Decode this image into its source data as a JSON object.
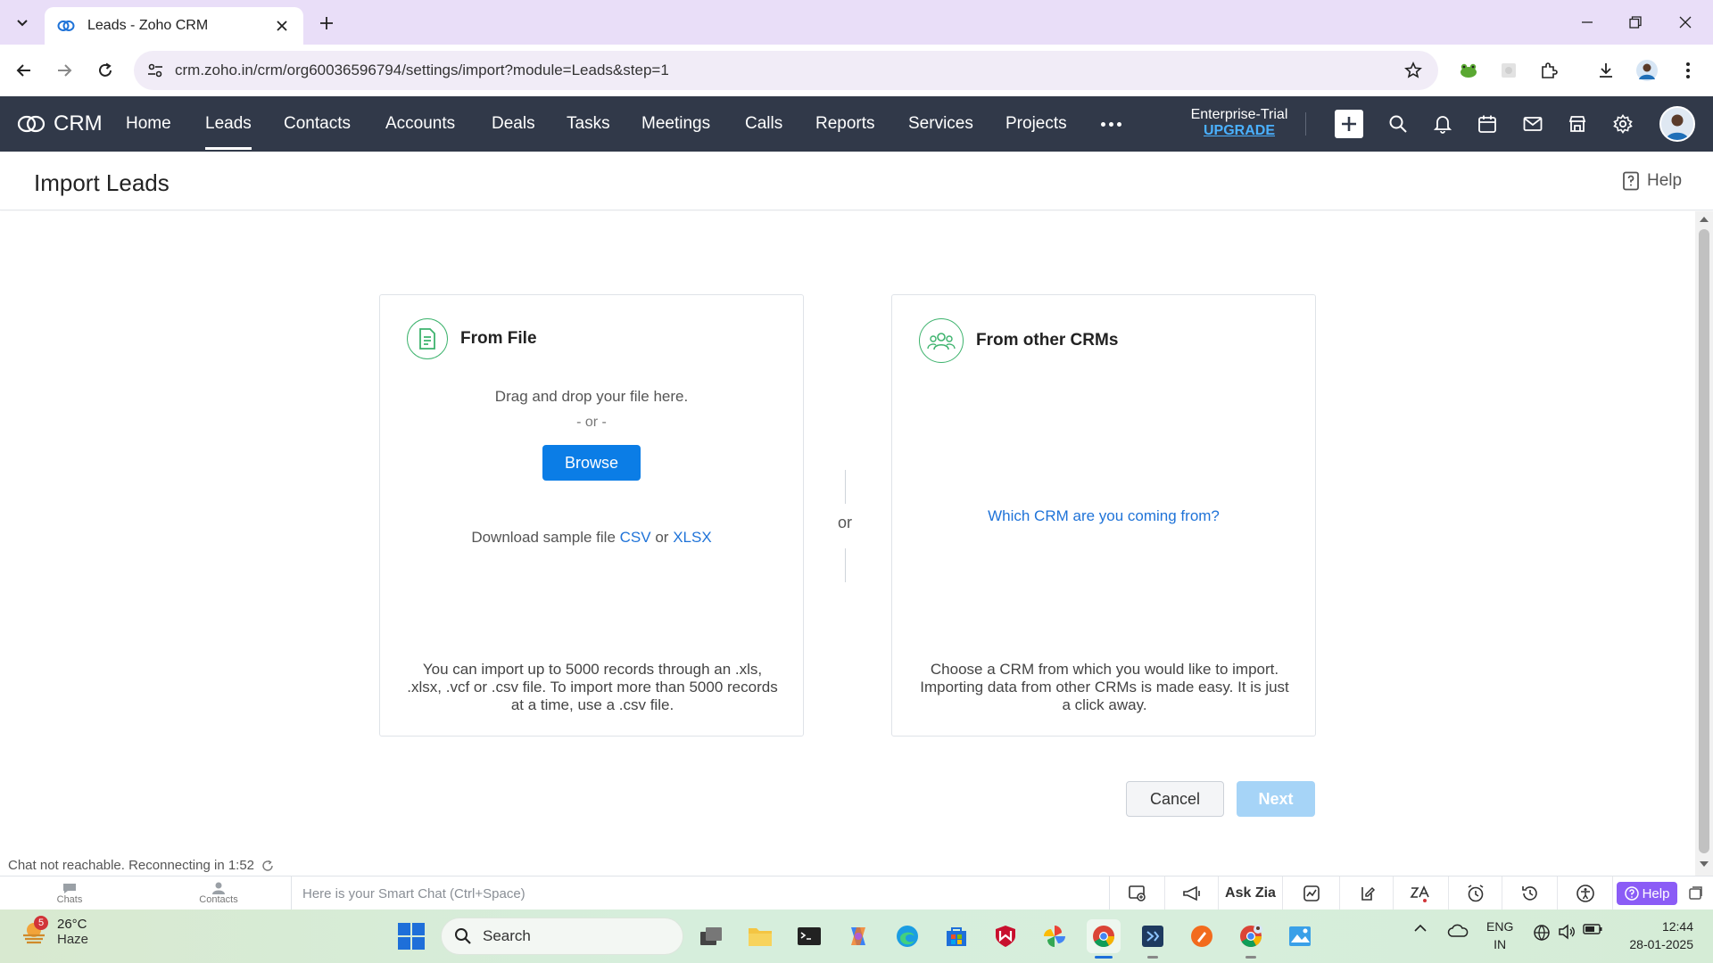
{
  "browser": {
    "tab_title": "Leads - Zoho CRM",
    "url": "crm.zoho.in/crm/org60036596794/settings/import?module=Leads&step=1"
  },
  "crm": {
    "brand": "CRM",
    "nav_tabs": [
      "Home",
      "Leads",
      "Contacts",
      "Accounts",
      "Deals",
      "Tasks",
      "Meetings",
      "Calls",
      "Reports",
      "Services",
      "Projects"
    ],
    "active_tab": "Leads",
    "plan_name": "Enterprise-Trial",
    "upgrade_label": "UPGRADE"
  },
  "page": {
    "title": "Import Leads",
    "help_label": "Help"
  },
  "from_file": {
    "title": "From File",
    "drag_text": "Drag and drop your file here.",
    "or_text": "- or -",
    "browse_label": "Browse",
    "sample_prefix": "Download sample file",
    "sample_csv": "CSV",
    "sample_or": "or",
    "sample_xlsx": "XLSX",
    "footer": "You can import up to 5000 records through an .xls, .xlsx, .vcf or .csv file. To import more than 5000 records at a time, use a .csv file."
  },
  "divider_or": "or",
  "from_crm": {
    "title": "From other CRMs",
    "question_link": "Which CRM are you coming from?",
    "footer": "Choose a CRM from which you would like to import. Importing data from other CRMs is made easy. It is just a click away."
  },
  "actions": {
    "cancel_label": "Cancel",
    "next_label": "Next"
  },
  "chat": {
    "status": "Chat not reachable. Reconnecting in 1:52"
  },
  "bottom_bar": {
    "chats_label": "Chats",
    "contacts_label": "Contacts",
    "smart_chat_placeholder": "Here is your Smart Chat (Ctrl+Space)",
    "ask_zia_label": "Ask Zia",
    "help_label": "Help"
  },
  "taskbar": {
    "weather_badge": "5",
    "temperature": "26°C",
    "condition": "Haze",
    "search_label": "Search",
    "lang_top": "ENG",
    "lang_bottom": "IN",
    "time": "12:44",
    "date": "28-01-2025"
  },
  "colors": {
    "crm_nav_bg": "#313949",
    "primary_blue": "#0b7de6",
    "link_blue": "#1f73d8",
    "upgrade_blue": "#4ab1ff",
    "icon_green": "#3db36d",
    "next_disabled": "#a6d4f7",
    "help_purple": "#8b5cf6"
  }
}
